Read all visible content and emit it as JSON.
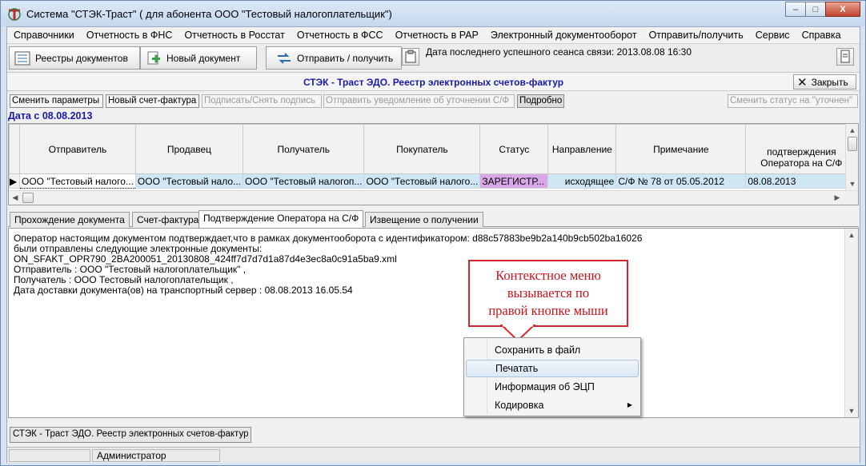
{
  "window": {
    "title": "Система \"СТЭК-Траст\" ( для абонента ООО \"Тестовый налогоплательщик\")",
    "minimize": "–",
    "maximize": "□",
    "close": "X"
  },
  "menu": [
    "Справочники",
    "Отчетность в ФНС",
    "Отчетность в Росстат",
    "Отчетность в ФСС",
    "Отчетность в РАР",
    "Электронный документооборот",
    "Отправить/получить",
    "Сервис",
    "Справка"
  ],
  "toolbar": {
    "registries": "Реестры документов",
    "new_document": "Новый документ",
    "send_receive": "Отправить / получить",
    "last_session": "Дата последнего успешного сеанса связи: 2013.08.08 16:30"
  },
  "header": {
    "title": "СТЭК - Траст ЭДО. Реестр электронных счетов-фактур",
    "close": "Закрыть"
  },
  "actions": {
    "change_params": "Сменить параметры",
    "new_invoice": "Новый счет-фактура",
    "sign": "Подписать/Снять подпись",
    "send_notice": "Отправить уведомление об уточнении С/Ф",
    "details": "Подробно",
    "change_status": "Сменить статус на \"уточнен\""
  },
  "date_filter": "Дата с 08.08.2013",
  "grid": {
    "columns": [
      "Отправитель",
      "Продавец",
      "Получатель",
      "Покупатель",
      "Статус",
      "Направление",
      "Примечание",
      "подтверждения Оператора на С/Ф"
    ],
    "rows": [
      {
        "sender": "ООО \"Тестовый налого...",
        "seller": "ООО \"Тестовый нало...",
        "receiver": "ООО \"Тестовый налогоп...",
        "buyer": "ООО \"Тестовый налого...",
        "status": "ЗАРЕГИСТР...",
        "direction": "исходящее",
        "note": "С/Ф № 78 от 05.05.2012",
        "confirm_date": "08.08.2013"
      }
    ]
  },
  "tabs": [
    "Прохождение документа",
    "Счет-фактура",
    "Подтверждение Оператора на С/Ф",
    "Извещение о получении"
  ],
  "document_text": [
    "Оператор настоящим документом подтверждает,что в рамках документооборота с идентификатором: d88c57883be9b2a140b9cb502ba16026",
    "были отправлены следующие электронные документы:",
    "ON_SFAKT_OPR790_2BA200051_20130808_424ff7d7d7d1a87d4e3ec8a0c91a5ba9.xml",
    "Отправитель     : ООО \"Тестовый налогоплательщик\" ,",
    "Получатель     : ООО Тестовый налогоплательщик ,",
    "Дата доставки документа(ов) на транспортный сервер : 08.08.2013 16.05.54"
  ],
  "callout": {
    "line1": "Контекстное меню",
    "line2": "вызывается по",
    "line3": "правой кнопке мыши"
  },
  "context_menu": [
    "Сохранить в файл",
    "Печатать",
    "Информация об ЭЦП",
    "Кодировка"
  ],
  "mdi_tab": "СТЭК - Траст ЭДО. Реестр электронных счетов-фактур",
  "status": {
    "user": "Администратор"
  },
  "colors": {
    "accent_blue": "#1a1aa8",
    "status_purple": "#d8a8e8",
    "callout_red": "#c8141c"
  }
}
